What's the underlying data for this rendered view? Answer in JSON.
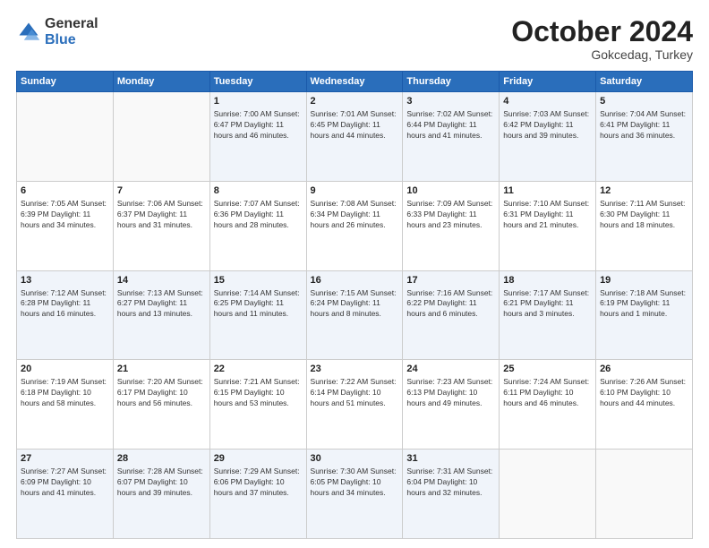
{
  "header": {
    "logo": {
      "general": "General",
      "blue": "Blue"
    },
    "title": "October 2024",
    "subtitle": "Gokcedag, Turkey"
  },
  "days_of_week": [
    "Sunday",
    "Monday",
    "Tuesday",
    "Wednesday",
    "Thursday",
    "Friday",
    "Saturday"
  ],
  "weeks": [
    [
      {
        "day": "",
        "info": ""
      },
      {
        "day": "",
        "info": ""
      },
      {
        "day": "1",
        "info": "Sunrise: 7:00 AM\nSunset: 6:47 PM\nDaylight: 11 hours and 46 minutes."
      },
      {
        "day": "2",
        "info": "Sunrise: 7:01 AM\nSunset: 6:45 PM\nDaylight: 11 hours and 44 minutes."
      },
      {
        "day": "3",
        "info": "Sunrise: 7:02 AM\nSunset: 6:44 PM\nDaylight: 11 hours and 41 minutes."
      },
      {
        "day": "4",
        "info": "Sunrise: 7:03 AM\nSunset: 6:42 PM\nDaylight: 11 hours and 39 minutes."
      },
      {
        "day": "5",
        "info": "Sunrise: 7:04 AM\nSunset: 6:41 PM\nDaylight: 11 hours and 36 minutes."
      }
    ],
    [
      {
        "day": "6",
        "info": "Sunrise: 7:05 AM\nSunset: 6:39 PM\nDaylight: 11 hours and 34 minutes."
      },
      {
        "day": "7",
        "info": "Sunrise: 7:06 AM\nSunset: 6:37 PM\nDaylight: 11 hours and 31 minutes."
      },
      {
        "day": "8",
        "info": "Sunrise: 7:07 AM\nSunset: 6:36 PM\nDaylight: 11 hours and 28 minutes."
      },
      {
        "day": "9",
        "info": "Sunrise: 7:08 AM\nSunset: 6:34 PM\nDaylight: 11 hours and 26 minutes."
      },
      {
        "day": "10",
        "info": "Sunrise: 7:09 AM\nSunset: 6:33 PM\nDaylight: 11 hours and 23 minutes."
      },
      {
        "day": "11",
        "info": "Sunrise: 7:10 AM\nSunset: 6:31 PM\nDaylight: 11 hours and 21 minutes."
      },
      {
        "day": "12",
        "info": "Sunrise: 7:11 AM\nSunset: 6:30 PM\nDaylight: 11 hours and 18 minutes."
      }
    ],
    [
      {
        "day": "13",
        "info": "Sunrise: 7:12 AM\nSunset: 6:28 PM\nDaylight: 11 hours and 16 minutes."
      },
      {
        "day": "14",
        "info": "Sunrise: 7:13 AM\nSunset: 6:27 PM\nDaylight: 11 hours and 13 minutes."
      },
      {
        "day": "15",
        "info": "Sunrise: 7:14 AM\nSunset: 6:25 PM\nDaylight: 11 hours and 11 minutes."
      },
      {
        "day": "16",
        "info": "Sunrise: 7:15 AM\nSunset: 6:24 PM\nDaylight: 11 hours and 8 minutes."
      },
      {
        "day": "17",
        "info": "Sunrise: 7:16 AM\nSunset: 6:22 PM\nDaylight: 11 hours and 6 minutes."
      },
      {
        "day": "18",
        "info": "Sunrise: 7:17 AM\nSunset: 6:21 PM\nDaylight: 11 hours and 3 minutes."
      },
      {
        "day": "19",
        "info": "Sunrise: 7:18 AM\nSunset: 6:19 PM\nDaylight: 11 hours and 1 minute."
      }
    ],
    [
      {
        "day": "20",
        "info": "Sunrise: 7:19 AM\nSunset: 6:18 PM\nDaylight: 10 hours and 58 minutes."
      },
      {
        "day": "21",
        "info": "Sunrise: 7:20 AM\nSunset: 6:17 PM\nDaylight: 10 hours and 56 minutes."
      },
      {
        "day": "22",
        "info": "Sunrise: 7:21 AM\nSunset: 6:15 PM\nDaylight: 10 hours and 53 minutes."
      },
      {
        "day": "23",
        "info": "Sunrise: 7:22 AM\nSunset: 6:14 PM\nDaylight: 10 hours and 51 minutes."
      },
      {
        "day": "24",
        "info": "Sunrise: 7:23 AM\nSunset: 6:13 PM\nDaylight: 10 hours and 49 minutes."
      },
      {
        "day": "25",
        "info": "Sunrise: 7:24 AM\nSunset: 6:11 PM\nDaylight: 10 hours and 46 minutes."
      },
      {
        "day": "26",
        "info": "Sunrise: 7:26 AM\nSunset: 6:10 PM\nDaylight: 10 hours and 44 minutes."
      }
    ],
    [
      {
        "day": "27",
        "info": "Sunrise: 7:27 AM\nSunset: 6:09 PM\nDaylight: 10 hours and 41 minutes."
      },
      {
        "day": "28",
        "info": "Sunrise: 7:28 AM\nSunset: 6:07 PM\nDaylight: 10 hours and 39 minutes."
      },
      {
        "day": "29",
        "info": "Sunrise: 7:29 AM\nSunset: 6:06 PM\nDaylight: 10 hours and 37 minutes."
      },
      {
        "day": "30",
        "info": "Sunrise: 7:30 AM\nSunset: 6:05 PM\nDaylight: 10 hours and 34 minutes."
      },
      {
        "day": "31",
        "info": "Sunrise: 7:31 AM\nSunset: 6:04 PM\nDaylight: 10 hours and 32 minutes."
      },
      {
        "day": "",
        "info": ""
      },
      {
        "day": "",
        "info": ""
      }
    ]
  ]
}
